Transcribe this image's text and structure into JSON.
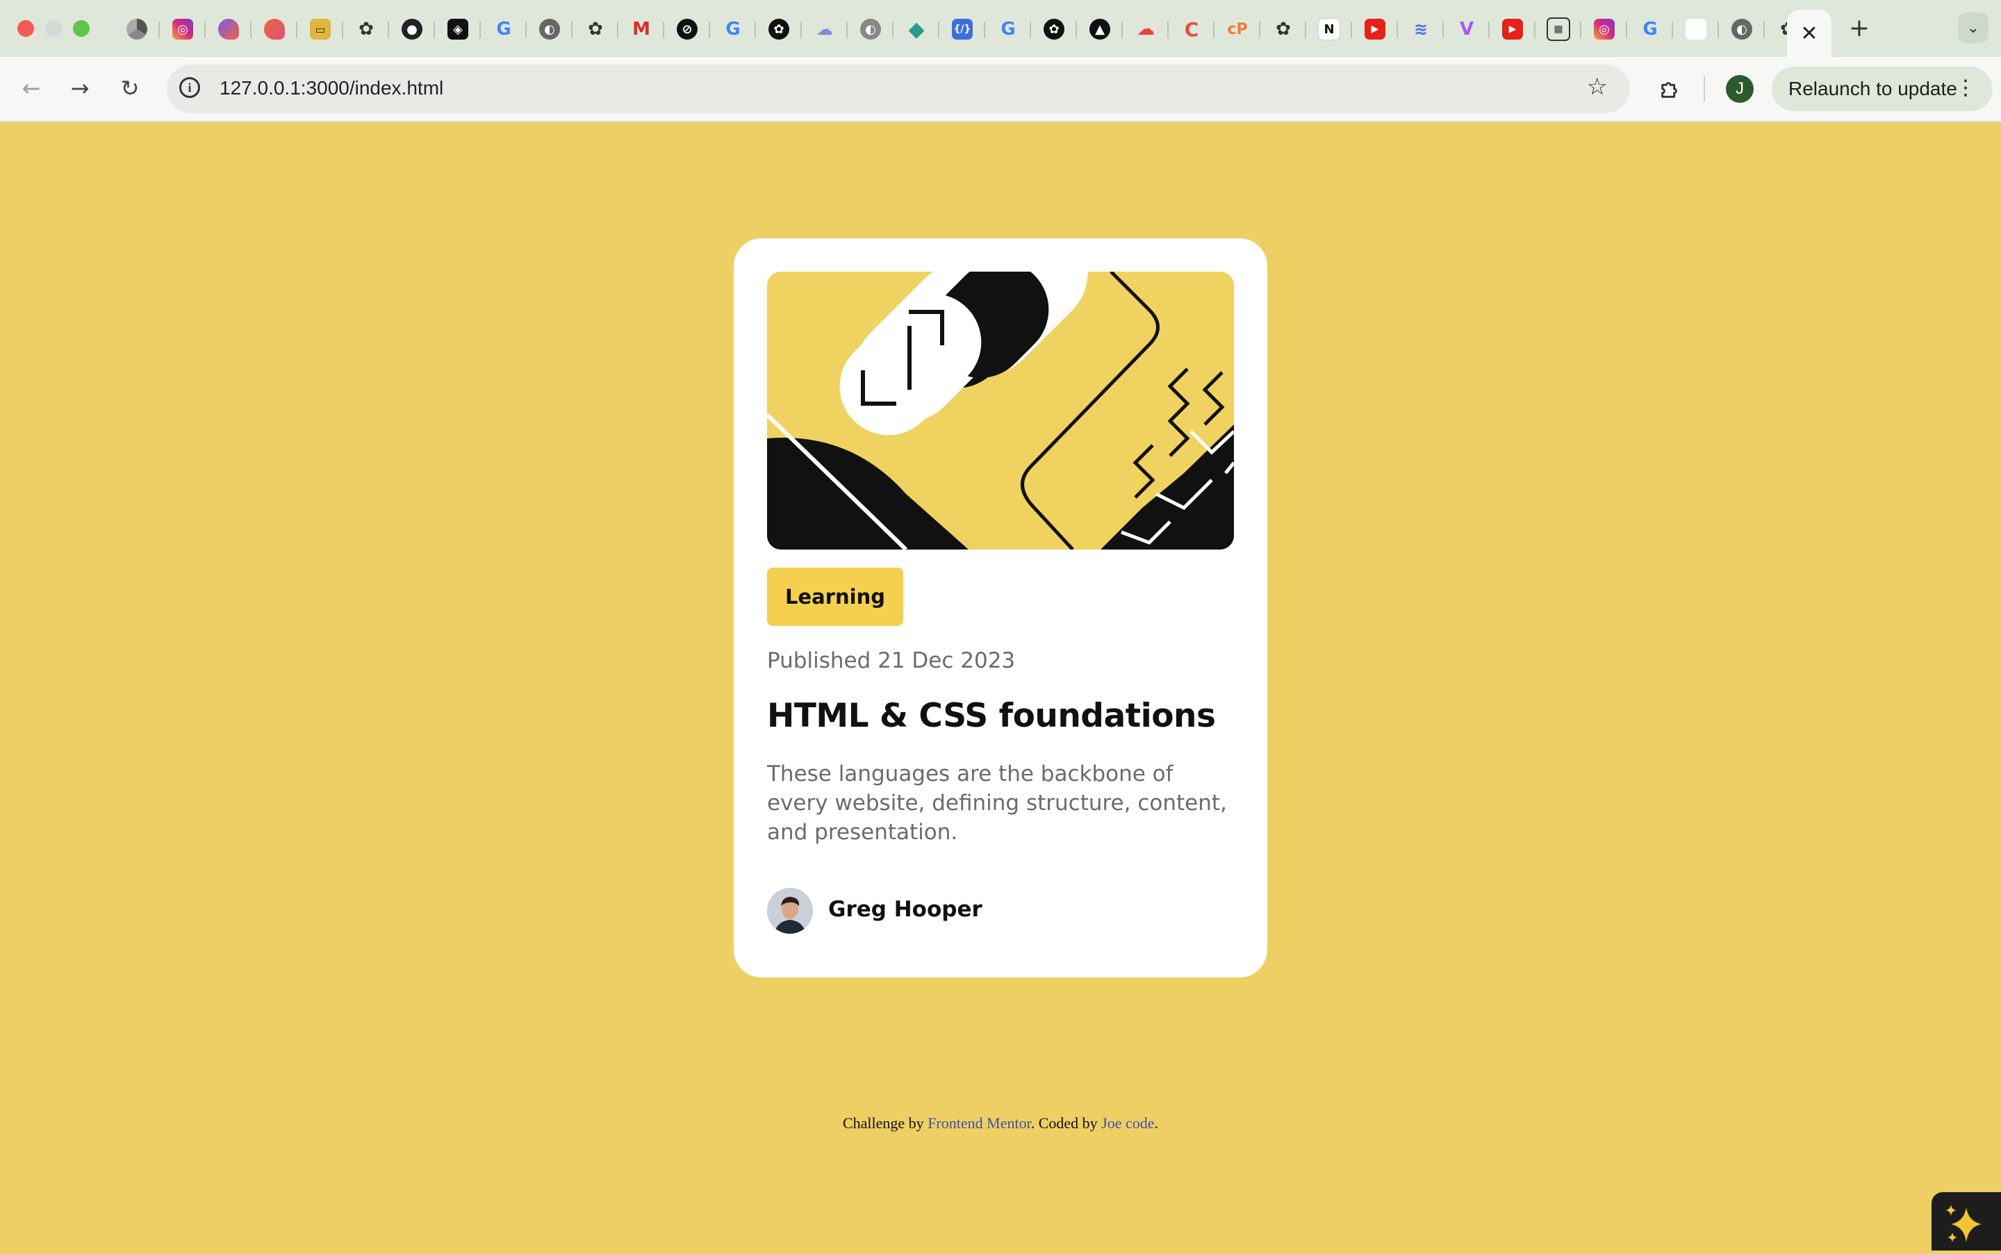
{
  "browser": {
    "url": "127.0.0.1:3000/index.html",
    "relaunch_label": "Relaunch to update",
    "profile_initial": "J",
    "close_tab_glyph": "✕",
    "new_tab_glyph": "+",
    "tab_icons": [
      "chrome-icon",
      "instagram-icon",
      "claude-icon",
      "claude-icon",
      "folder-icon",
      "openai-icon",
      "github-icon",
      "notion-icon",
      "google-icon",
      "globe-icon",
      "openai-icon",
      "gmail-icon",
      "perplexity-icon",
      "google-icon",
      "openai-icon",
      "cloud-icon",
      "globe-icon",
      "diamond-icon",
      "code-icon",
      "google-icon",
      "openai-icon",
      "apps-icon",
      "google-cloud-icon",
      "c-icon",
      "copilot-icon",
      "openai-icon",
      "notion-icon",
      "youtube-icon",
      "deepseek-icon",
      "vite-icon",
      "youtube-icon",
      "grid-icon",
      "instagram-icon",
      "google-icon",
      "blank-page-icon",
      "globe-icon",
      "openai-icon"
    ]
  },
  "card": {
    "tag": "Learning",
    "published": "Published 21 Dec 2023",
    "title": "HTML & CSS foundations",
    "description": "These languages are the backbone of every website, defining structure, content, and presentation.",
    "author": "Greg Hooper"
  },
  "attribution": {
    "prefix": "Challenge by ",
    "link1": "Frontend Mentor",
    "middle": ". Coded by ",
    "link2": "Joe code",
    "suffix": "."
  },
  "colors": {
    "page_bg": "#edcf63",
    "card_bg": "#ffffff",
    "tag_bg": "#f4d04e",
    "text_dark": "#111111",
    "text_muted": "#6b6b6b"
  }
}
